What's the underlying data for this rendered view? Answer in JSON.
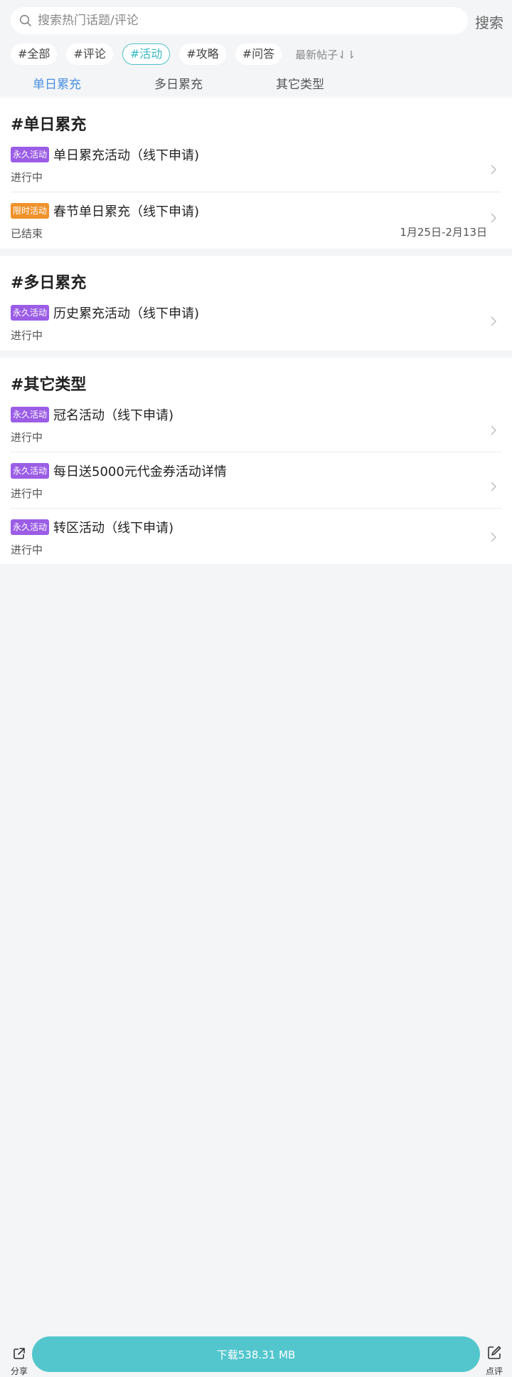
{
  "search": {
    "placeholder": "搜索热门话题/评论",
    "button": "搜索"
  },
  "tags": [
    "#全部",
    "#评论",
    "#活动",
    "#攻略",
    "#问答"
  ],
  "active_tag": "#活动",
  "sort_label": "最新帖子⇃⇂",
  "subtabs": [
    "单日累充",
    "多日累充",
    "其它类型"
  ],
  "sections": [
    {
      "title": "#单日累充",
      "items": [
        {
          "badge": "永久活动",
          "title": "单日累充活动（线下申请)",
          "status": "进行中",
          "date": ""
        },
        {
          "badge": "限时活动",
          "title": "春节单日累充（线下申请)",
          "status": "已结束",
          "date": "1月25日-2月13日"
        }
      ]
    },
    {
      "title": "#多日累充",
      "items": [
        {
          "badge": "永久活动",
          "title": "历史累充活动（线下申请)",
          "status": "进行中",
          "date": ""
        }
      ]
    },
    {
      "title": "#其它类型",
      "items": [
        {
          "badge": "永久活动",
          "title": "冠名活动（线下申请)",
          "status": "进行中",
          "date": ""
        },
        {
          "badge": "永久活动",
          "title": "每日送5000元代金券活动详情",
          "status": "进行中",
          "date": ""
        },
        {
          "badge": "永久活动",
          "title": "转区活动（线下申请)",
          "status": "进行中",
          "date": ""
        }
      ]
    }
  ],
  "bottom": {
    "share": "分享",
    "download": "下载538.31 MB",
    "review": "点评"
  },
  "colors": {
    "accent": "#53c6cd",
    "tab_active": "#4a90e2",
    "badge_permanent": "#9b5de5",
    "badge_limited": "#f0922b"
  }
}
